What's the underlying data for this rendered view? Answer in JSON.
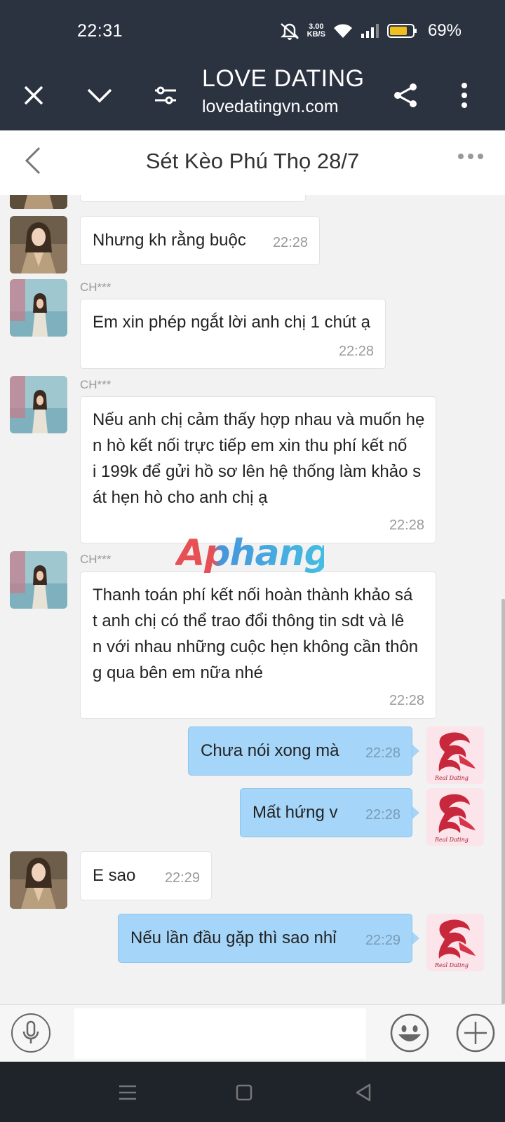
{
  "status_bar": {
    "time": "22:31",
    "net_speed_value": "3.00",
    "net_speed_unit": "KB/S",
    "battery_percent": "69%"
  },
  "browser": {
    "title": "LOVE DATING",
    "url": "lovedatingvn.com"
  },
  "chat": {
    "title": "Sét Kèo Phú Thọ 28/7",
    "messages": [
      {
        "direction": "in",
        "text": "Nhưng kh rằng buộc",
        "time": "22:28"
      },
      {
        "direction": "in",
        "sender": "CH***",
        "text": "Em xin phép ngắt lời anh chị 1 chút ạ",
        "time": "22:28"
      },
      {
        "direction": "in",
        "sender": "CH***",
        "lines": [
          "Nếu anh chị cảm thấy hợp nhau và muốn hẹ",
          "n hò kết nối trực tiếp  em xin thu phí kết nố",
          "i 199k để gửi hồ sơ lên hệ thống làm khảo s",
          "át hẹn hò cho anh chị ạ"
        ],
        "time": "22:28"
      },
      {
        "direction": "in",
        "sender": "CH***",
        "lines": [
          "Thanh toán phí kết nối hoàn thành khảo sá",
          "t anh chị có thể trao đổi thông tin sdt và lê",
          "n với nhau những cuộc hẹn không cần thôn",
          "g qua bên em nữa nhé"
        ],
        "time": "22:28"
      },
      {
        "direction": "out",
        "text": "Chưa nói xong mà",
        "time": "22:28"
      },
      {
        "direction": "out",
        "text": "Mất hứng v",
        "time": "22:28"
      },
      {
        "direction": "in",
        "text": "E sao",
        "time": "22:29"
      },
      {
        "direction": "out",
        "text": "Nếu lần đầu gặp thì sao nhỉ",
        "time": "22:29"
      }
    ]
  },
  "watermark": "Aphang",
  "avatar_logo_text": "Real Dating",
  "colors": {
    "header_bg": "#2b3340",
    "bubble_out": "#a5d5f8",
    "bubble_in": "#ffffff",
    "chat_bg": "#f2f2f2",
    "nav_bg": "#1f232a"
  },
  "icons": [
    "close-icon",
    "chevron-down-icon",
    "filter-icon",
    "share-icon",
    "more-vertical-icon",
    "back-icon",
    "more-horizontal-icon",
    "mic-icon",
    "emoji-icon",
    "plus-icon",
    "menu-icon",
    "home-icon",
    "back-triangle-icon"
  ]
}
